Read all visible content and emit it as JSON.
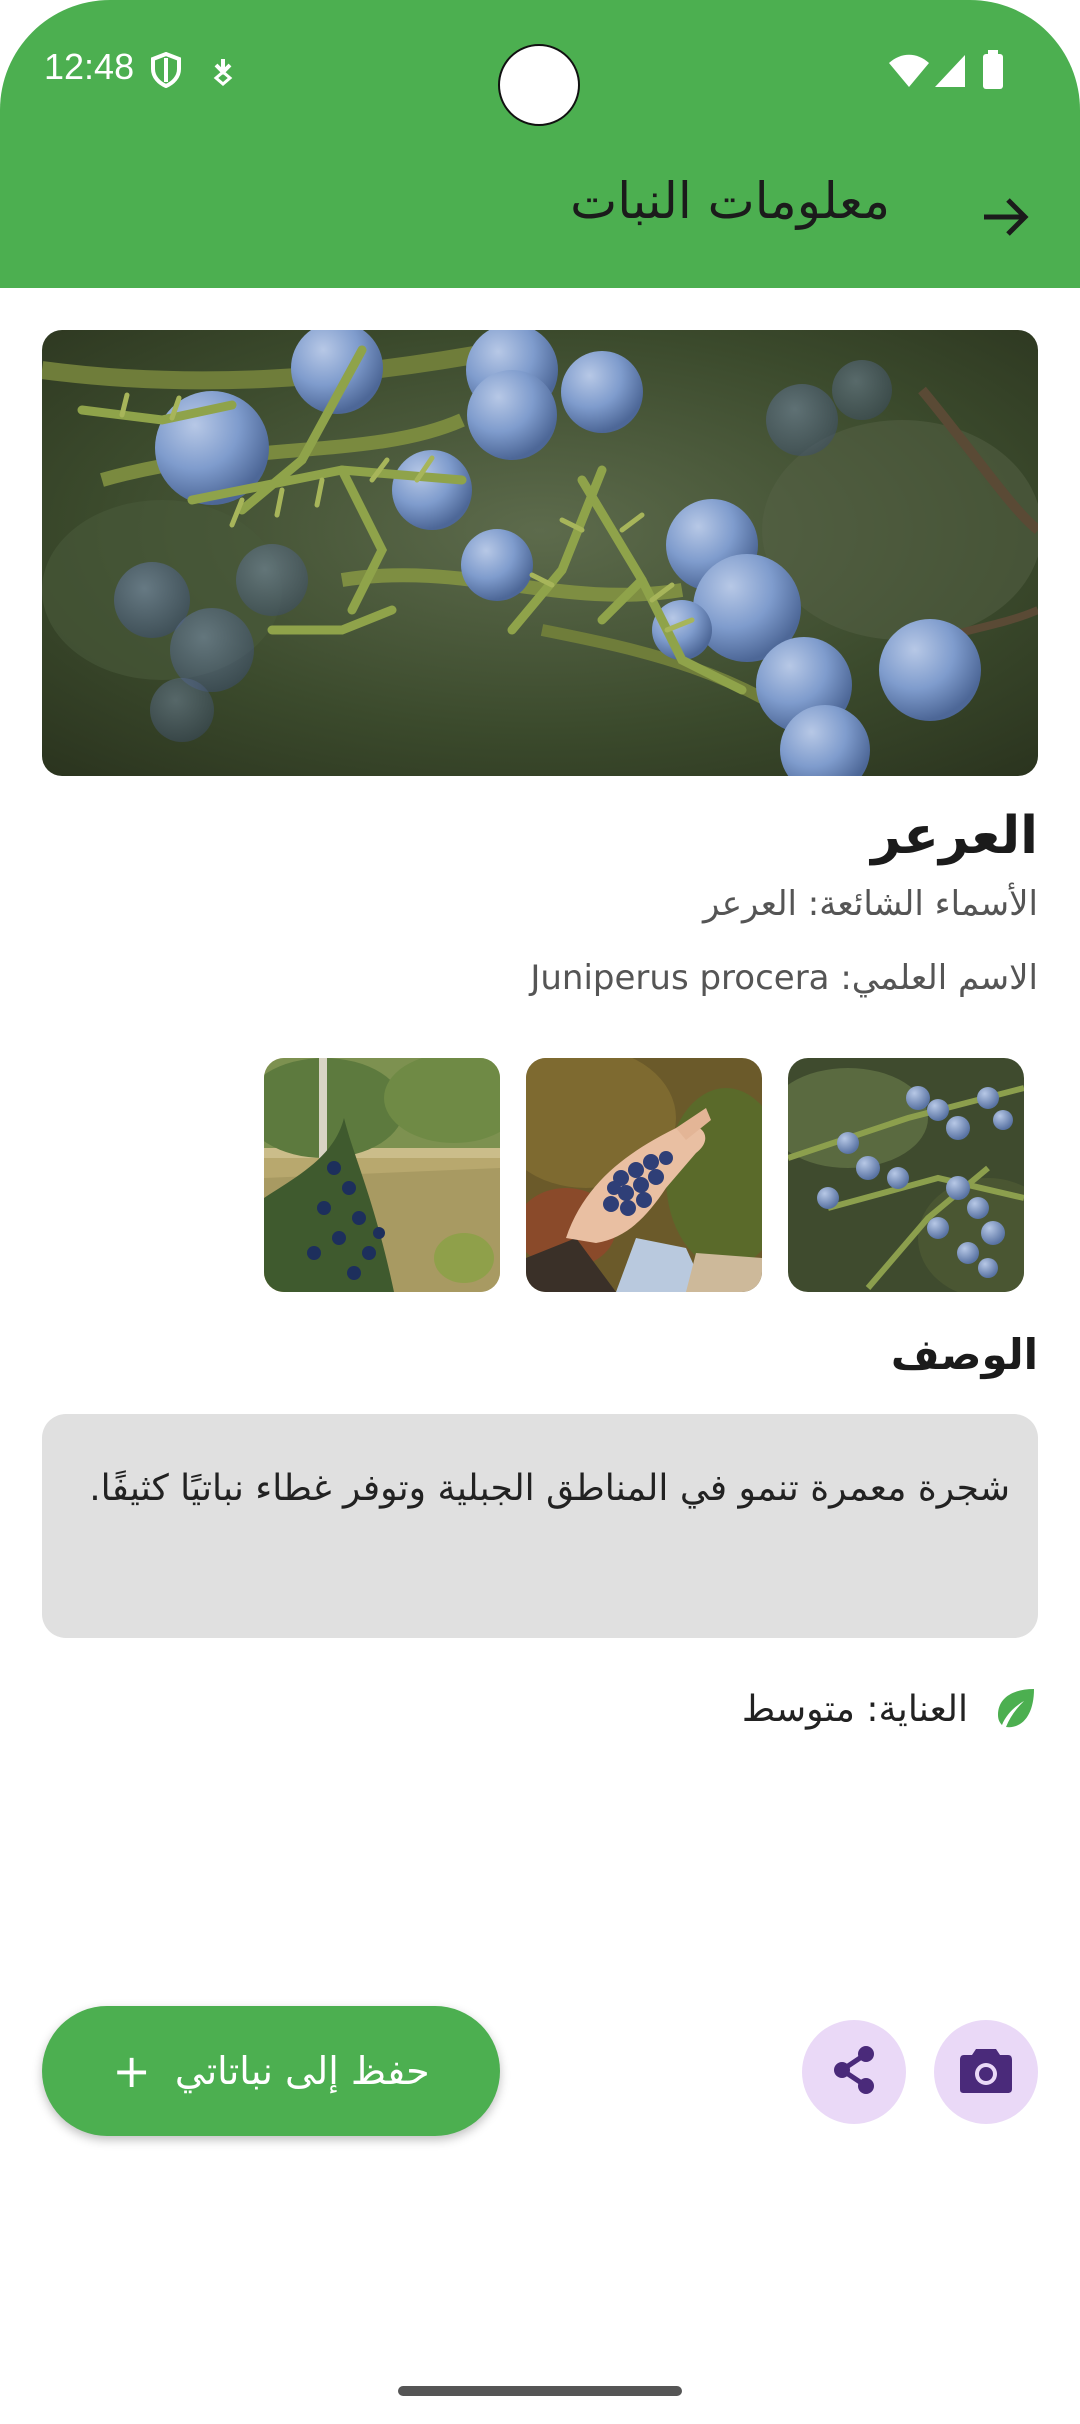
{
  "status_bar": {
    "time": "12:48"
  },
  "header": {
    "title": "معلومات النبات"
  },
  "plant": {
    "name": "العرعر",
    "common_names": "الأسماء الشائعة: العرعر",
    "scientific_name": "الاسم العلمي: Juniperus procera"
  },
  "description": {
    "title": "الوصف",
    "text": "شجرة معمرة تنمو في المناطق الجبلية وتوفر غطاء نباتيًا كثيفًا."
  },
  "care": {
    "text": "العناية: متوسط"
  },
  "actions": {
    "save_label": "حفظ إلى نباتاتي",
    "save_plus": "+"
  },
  "colors": {
    "primary": "#4caf50",
    "card_bg": "#e0e0e0",
    "icon_button_bg": "#ead9f7",
    "icon_purple": "#4a2a7a"
  }
}
